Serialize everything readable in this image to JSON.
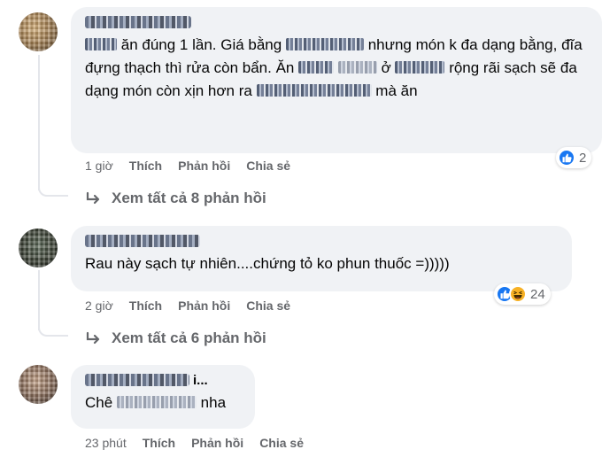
{
  "comments": [
    {
      "text": {
        "p1": "ăn đúng 1 lần. Giá bằng",
        "p2": "nhưng món k đa dạng bằng, đĩa đựng thạch thì rửa còn bẩn. Ăn",
        "p3": "ở",
        "p4": "rộng rãi sạch sẽ đa dạng món còn xịn hơn ra",
        "p5": "mà ăn"
      },
      "time": "1 giờ",
      "like": "Thích",
      "reply": "Phản hồi",
      "share": "Chia sẻ",
      "reaction_count": "2",
      "reaction_icons": [
        "like-icon"
      ],
      "view_replies": "Xem tất cả 8 phản hồi"
    },
    {
      "text": "Rau này sạch tự nhiên....chứng tỏ ko phun thuốc =)))))",
      "time": "2 giờ",
      "like": "Thích",
      "reply": "Phản hồi",
      "share": "Chia sẻ",
      "reaction_count": "24",
      "reaction_icons": [
        "like-icon",
        "haha-icon"
      ],
      "view_replies": "Xem tất cả 6 phản hồi"
    },
    {
      "author_suffix": "i...",
      "text": {
        "p1": "Chê",
        "p2": "nha"
      },
      "time": "23 phút",
      "like": "Thích",
      "reply": "Phản hồi",
      "share": "Chia sẻ"
    }
  ],
  "colors": {
    "bubble": "#f0f2f5",
    "meta_text": "#65676b",
    "like_blue": "#1877f2",
    "haha_yellow": "#f7b125"
  }
}
